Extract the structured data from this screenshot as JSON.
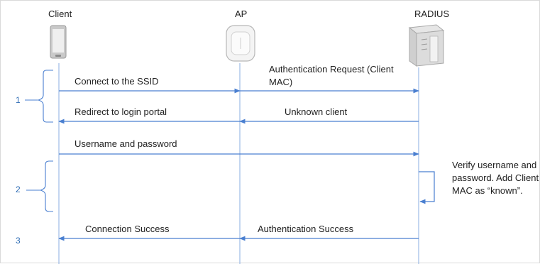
{
  "participants": {
    "client": "Client",
    "ap": "AP",
    "radius": "RADIUS"
  },
  "messages": {
    "m1": "Connect to the SSID",
    "m2a": "Authentication Request (Client",
    "m2b": "MAC)",
    "m3": "Redirect to login portal",
    "m4": "Unknown client",
    "m5": "Username and password",
    "m6": "Connection Success",
    "m7": "Authentication Success"
  },
  "note": "Verify username and password. Add Client MAC as “known”.",
  "steps": {
    "s1": "1",
    "s2": "2",
    "s3": "3"
  },
  "colors": {
    "arrow": "#4a7fd0",
    "lifeline": "#8aaee0",
    "brace": "#4a7fd0",
    "device": "#e0e0e0"
  }
}
